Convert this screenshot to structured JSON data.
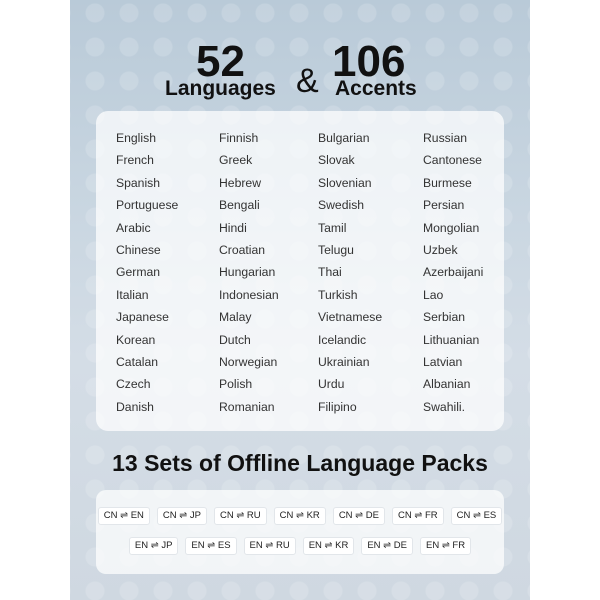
{
  "headline": {
    "languages_count": "52",
    "languages_label": "Languages",
    "ampersand": "&",
    "accents_count": "106",
    "accents_label": "Accents"
  },
  "languages": {
    "col1": [
      "English",
      "French",
      "Spanish",
      "Portuguese",
      "Arabic",
      "Chinese",
      "German",
      "Italian",
      "Japanese",
      "Korean",
      "Catalan",
      "Czech",
      "Danish"
    ],
    "col2": [
      "Finnish",
      "Greek",
      "Hebrew",
      "Bengali",
      "Hindi",
      "Croatian",
      "Hungarian",
      "Indonesian",
      "Malay",
      "Dutch",
      "Norwegian",
      "Polish",
      "Romanian"
    ],
    "col3": [
      "Bulgarian",
      "Slovak",
      "Slovenian",
      "Swedish",
      "Tamil",
      "Telugu",
      "Thai",
      "Turkish",
      "Vietnamese",
      "Icelandic",
      "Ukrainian",
      "Urdu",
      "Filipino"
    ],
    "col4": [
      "Russian",
      "Cantonese",
      "Burmese",
      "Persian",
      "Mongolian",
      "Uzbek",
      "Azerbaijani",
      "Lao",
      "Serbian",
      "Lithuanian",
      "Latvian",
      "Albanian",
      "Swahili."
    ]
  },
  "packs": {
    "title": "13 Sets of Offline Language Packs",
    "row1": [
      "CN ⇌ EN",
      "CN ⇌ JP",
      "CN ⇌ RU",
      "CN ⇌ KR",
      "CN ⇌ DE",
      "CN ⇌ FR",
      "CN ⇌ ES"
    ],
    "row2": [
      "EN ⇌ JP",
      "EN ⇌ ES",
      "EN ⇌ RU",
      "EN ⇌ KR",
      "EN ⇌ DE",
      "EN ⇌ FR"
    ]
  }
}
